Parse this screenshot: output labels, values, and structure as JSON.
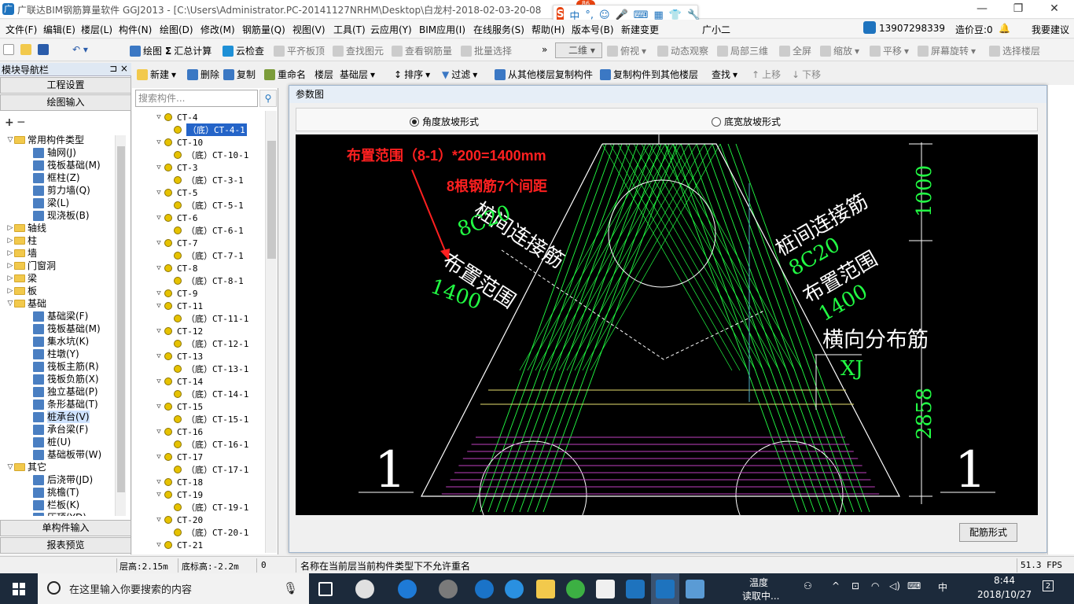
{
  "window": {
    "title": "广联达BIM钢筋算量软件 GGJ2013 - [C:\\Users\\Administrator.PC-20141127NRHM\\Desktop\\白龙村-2018-02-03-20-08",
    "controls": [
      "—",
      "❐",
      "✕"
    ]
  },
  "ime": {
    "logo": "S",
    "badge": "86",
    "lang": "中",
    "punct": "°,"
  },
  "menu": [
    "文件(F)",
    "编辑(E)",
    "楼层(L)",
    "构件(N)",
    "绘图(D)",
    "修改(M)",
    "钢筋量(Q)",
    "视图(V)",
    "工具(T)",
    "云应用(Y)",
    "BIM应用(I)",
    "在线服务(S)",
    "帮助(H)",
    "版本号(B)",
    "新建变更",
    "广小二"
  ],
  "account": {
    "phone": "13907298339",
    "beans": "造价豆:0",
    "suggest": "我要建议"
  },
  "toolbar1": {
    "items": [
      "绘图",
      "汇总计算",
      "云检查",
      "平齐板顶",
      "查找图元",
      "查看钢筋量",
      "批量选择"
    ],
    "view_combo": "二维",
    "view_items": [
      "俯视",
      "动态观察",
      "局部三维",
      "全屏",
      "缩放",
      "平移",
      "屏幕旋转",
      "选择楼层"
    ]
  },
  "nav": {
    "header": "模块导航栏",
    "pin": "⊐ ×",
    "btn_project": "工程设置",
    "btn_draw": "绘图输入",
    "btn_single": "单构件输入",
    "btn_report": "报表预览",
    "tree": [
      {
        "level": 0,
        "toggle": "▽",
        "label": "常用构件类型",
        "type": "folder"
      },
      {
        "level": 1,
        "toggle": "",
        "label": "轴网(J)",
        "type": "comp"
      },
      {
        "level": 1,
        "toggle": "",
        "label": "筏板基础(M)",
        "type": "comp"
      },
      {
        "level": 1,
        "toggle": "",
        "label": "框柱(Z)",
        "type": "comp"
      },
      {
        "level": 1,
        "toggle": "",
        "label": "剪力墙(Q)",
        "type": "comp"
      },
      {
        "level": 1,
        "toggle": "",
        "label": "梁(L)",
        "type": "comp"
      },
      {
        "level": 1,
        "toggle": "",
        "label": "现浇板(B)",
        "type": "comp"
      },
      {
        "level": 0,
        "toggle": "▷",
        "label": "轴线",
        "type": "folder"
      },
      {
        "level": 0,
        "toggle": "▷",
        "label": "柱",
        "type": "folder"
      },
      {
        "level": 0,
        "toggle": "▷",
        "label": "墙",
        "type": "folder"
      },
      {
        "level": 0,
        "toggle": "▷",
        "label": "门窗洞",
        "type": "folder"
      },
      {
        "level": 0,
        "toggle": "▷",
        "label": "梁",
        "type": "folder"
      },
      {
        "level": 0,
        "toggle": "▷",
        "label": "板",
        "type": "folder"
      },
      {
        "level": 0,
        "toggle": "▽",
        "label": "基础",
        "type": "folder"
      },
      {
        "level": 1,
        "toggle": "",
        "label": "基础梁(F)",
        "type": "comp"
      },
      {
        "level": 1,
        "toggle": "",
        "label": "筏板基础(M)",
        "type": "comp"
      },
      {
        "level": 1,
        "toggle": "",
        "label": "集水坑(K)",
        "type": "comp"
      },
      {
        "level": 1,
        "toggle": "",
        "label": "柱墩(Y)",
        "type": "comp"
      },
      {
        "level": 1,
        "toggle": "",
        "label": "筏板主筋(R)",
        "type": "comp"
      },
      {
        "level": 1,
        "toggle": "",
        "label": "筏板负筋(X)",
        "type": "comp"
      },
      {
        "level": 1,
        "toggle": "",
        "label": "独立基础(P)",
        "type": "comp"
      },
      {
        "level": 1,
        "toggle": "",
        "label": "条形基础(T)",
        "type": "comp"
      },
      {
        "level": 1,
        "toggle": "",
        "label": "桩承台(V)",
        "type": "comp",
        "selected": true
      },
      {
        "level": 1,
        "toggle": "",
        "label": "承台梁(F)",
        "type": "comp"
      },
      {
        "level": 1,
        "toggle": "",
        "label": "桩(U)",
        "type": "comp"
      },
      {
        "level": 1,
        "toggle": "",
        "label": "基础板带(W)",
        "type": "comp"
      },
      {
        "level": 0,
        "toggle": "▽",
        "label": "其它",
        "type": "folder"
      },
      {
        "level": 1,
        "toggle": "",
        "label": "后浇带(JD)",
        "type": "comp"
      },
      {
        "level": 1,
        "toggle": "",
        "label": "挑檐(T)",
        "type": "comp"
      },
      {
        "level": 1,
        "toggle": "",
        "label": "栏板(K)",
        "type": "comp"
      },
      {
        "level": 1,
        "toggle": "",
        "label": "压顶(YD)",
        "type": "comp"
      }
    ]
  },
  "toolbar2": {
    "items": [
      "新建",
      "删除",
      "复制",
      "重命名",
      "楼层",
      "基础层",
      "排序",
      "过滤",
      "从其他楼层复制构件",
      "复制构件到其他楼层",
      "查找",
      "上移",
      "下移"
    ]
  },
  "components": {
    "search_placeholder": "搜索构件...",
    "rows": [
      {
        "level": 0,
        "label": "CT-4"
      },
      {
        "level": 1,
        "label": "（底）CT-4-1",
        "selected": true
      },
      {
        "level": 0,
        "label": "CT-10"
      },
      {
        "level": 1,
        "label": "（底）CT-10-1"
      },
      {
        "level": 0,
        "label": "CT-3"
      },
      {
        "level": 1,
        "label": "（底）CT-3-1"
      },
      {
        "level": 0,
        "label": "CT-5"
      },
      {
        "level": 1,
        "label": "（底）CT-5-1"
      },
      {
        "level": 0,
        "label": "CT-6"
      },
      {
        "level": 1,
        "label": "（底）CT-6-1"
      },
      {
        "level": 0,
        "label": "CT-7"
      },
      {
        "level": 1,
        "label": "（底）CT-7-1"
      },
      {
        "level": 0,
        "label": "CT-8"
      },
      {
        "level": 1,
        "label": "（底）CT-8-1"
      },
      {
        "level": 0,
        "label": "CT-9"
      },
      {
        "level": 0,
        "label": "CT-11"
      },
      {
        "level": 1,
        "label": "（底）CT-11-1"
      },
      {
        "level": 0,
        "label": "CT-12"
      },
      {
        "level": 1,
        "label": "（底）CT-12-1"
      },
      {
        "level": 0,
        "label": "CT-13"
      },
      {
        "level": 1,
        "label": "（底）CT-13-1"
      },
      {
        "level": 0,
        "label": "CT-14"
      },
      {
        "level": 1,
        "label": "（底）CT-14-1"
      },
      {
        "level": 0,
        "label": "CT-15"
      },
      {
        "level": 1,
        "label": "（底）CT-15-1"
      },
      {
        "level": 0,
        "label": "CT-16"
      },
      {
        "level": 1,
        "label": "（底）CT-16-1"
      },
      {
        "level": 0,
        "label": "CT-17"
      },
      {
        "level": 1,
        "label": "（底）CT-17-1"
      },
      {
        "level": 0,
        "label": "CT-18"
      },
      {
        "level": 0,
        "label": "CT-19"
      },
      {
        "level": 1,
        "label": "（底）CT-19-1"
      },
      {
        "level": 0,
        "label": "CT-20"
      },
      {
        "level": 1,
        "label": "（底）CT-20-1"
      },
      {
        "level": 0,
        "label": "CT-21"
      }
    ]
  },
  "dialog": {
    "title": "参数图",
    "radio1": "角度放坡形式",
    "radio2": "底宽放坡形式",
    "button": "配筋形式",
    "drawing": {
      "annot_red1": "布置范围（8-1）*200=1400mm",
      "annot_red2": "8根钢筋7个间距",
      "left_label1": "桩间连接筋",
      "left_label2": "8C20",
      "left_label3": "布置范围",
      "left_label4": "1400",
      "right_label1": "桩间连接筋",
      "right_label2": "8C20",
      "right_label3": "布置范围",
      "right_label4": "1400",
      "dist_label": "横向分布筋",
      "dist_value": "XJ",
      "dim_top": "1000",
      "dim_main": "2858",
      "section_left": "1",
      "section_right": "1"
    }
  },
  "status": {
    "floor_height": "层高:2.15m",
    "bottom_elev": "底标高:-2.2m",
    "zero": "0",
    "message": "名称在当前层当前构件类型下不允许重名",
    "fps": "51.3 FPS"
  },
  "taskbar": {
    "search_placeholder": "在这里输入你要搜索的内容",
    "temp_label": "温度",
    "temp_value": "读取中...",
    "time": "8:44",
    "date": "2018/10/27",
    "notif": "2",
    "ime": "中"
  },
  "colors": {
    "title_blue": "#1e73be",
    "drawing_bg": "#000000",
    "rebar_green": "#22ff44",
    "annotation_red": "#ff2020",
    "stirrup_magenta": "#c040c0",
    "taskbar_bg": "#1c2a3b"
  }
}
